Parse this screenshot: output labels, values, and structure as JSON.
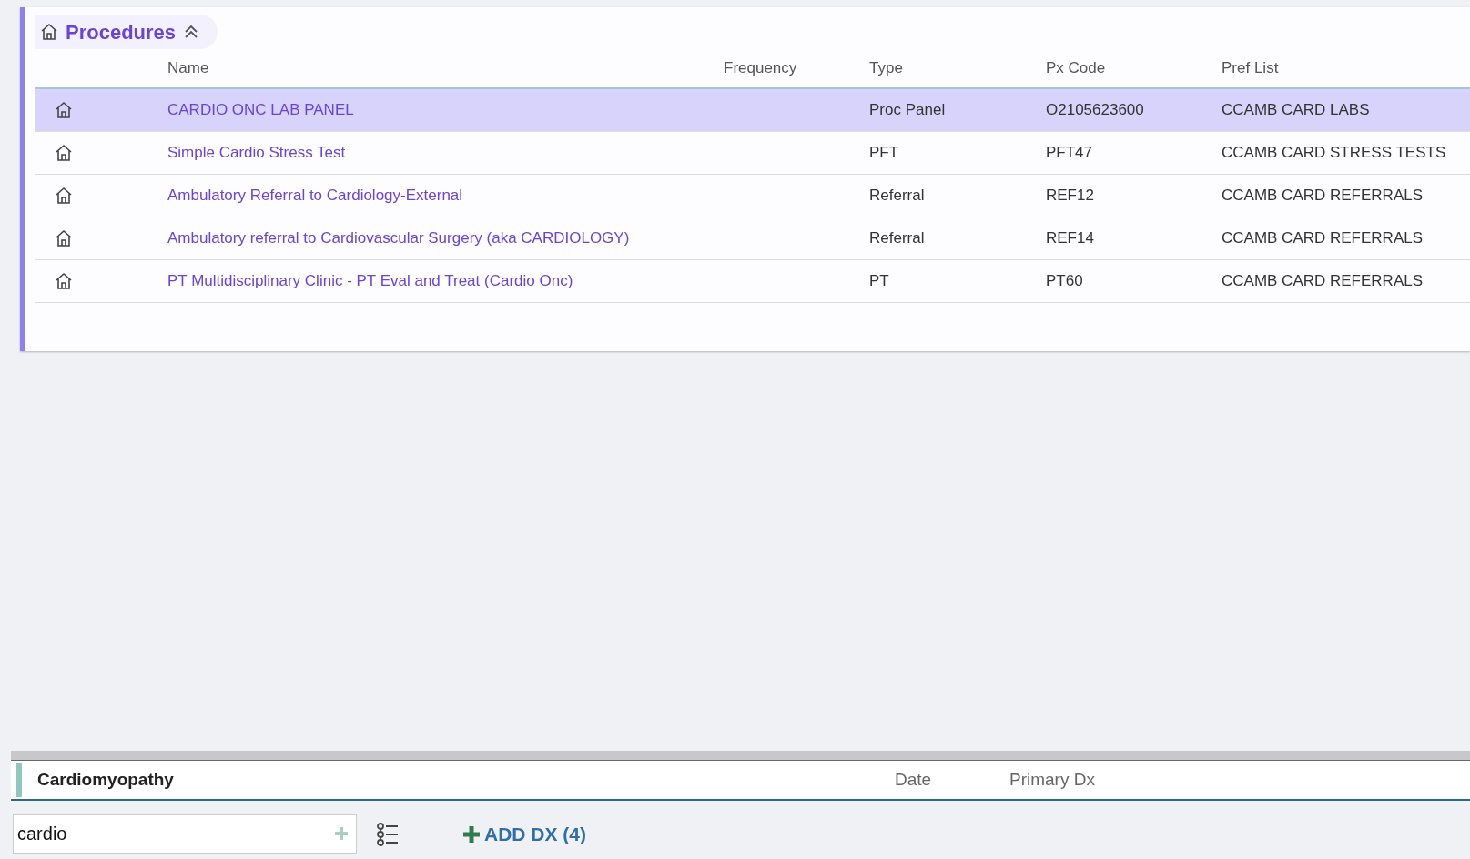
{
  "procedures": {
    "title": "Procedures",
    "columns": [
      "Name",
      "Frequency",
      "Type",
      "Px Code",
      "Pref List"
    ],
    "rows": [
      {
        "name": "CARDIO ONC LAB PANEL",
        "type": "Proc Panel",
        "px_code": "O2105623600",
        "pref_list": "CCAMB CARD LABS",
        "selected": true
      },
      {
        "name": "Simple Cardio Stress Test",
        "type": "PFT",
        "px_code": "PFT47",
        "pref_list": "CCAMB CARD STRESS TESTS",
        "selected": false
      },
      {
        "name": "Ambulatory Referral to Cardiology-External",
        "type": "Referral",
        "px_code": "REF12",
        "pref_list": "CCAMB CARD REFERRALS",
        "selected": false
      },
      {
        "name": "Ambulatory referral to Cardiovascular Surgery (aka CARDIOLOGY)",
        "type": "Referral",
        "px_code": "REF14",
        "pref_list": "CCAMB CARD REFERRALS",
        "selected": false
      },
      {
        "name": "PT Multidisciplinary Clinic - PT Eval and Treat (Cardio Onc)",
        "type": "PT",
        "px_code": "PT60",
        "pref_list": "CCAMB CARD REFERRALS",
        "selected": false
      }
    ]
  },
  "diagnosis": {
    "name": "Cardiomyopathy",
    "columns": [
      "Date",
      "Primary Dx"
    ]
  },
  "search": {
    "value": "cardio"
  },
  "add_button": "ADD DX (4)"
}
